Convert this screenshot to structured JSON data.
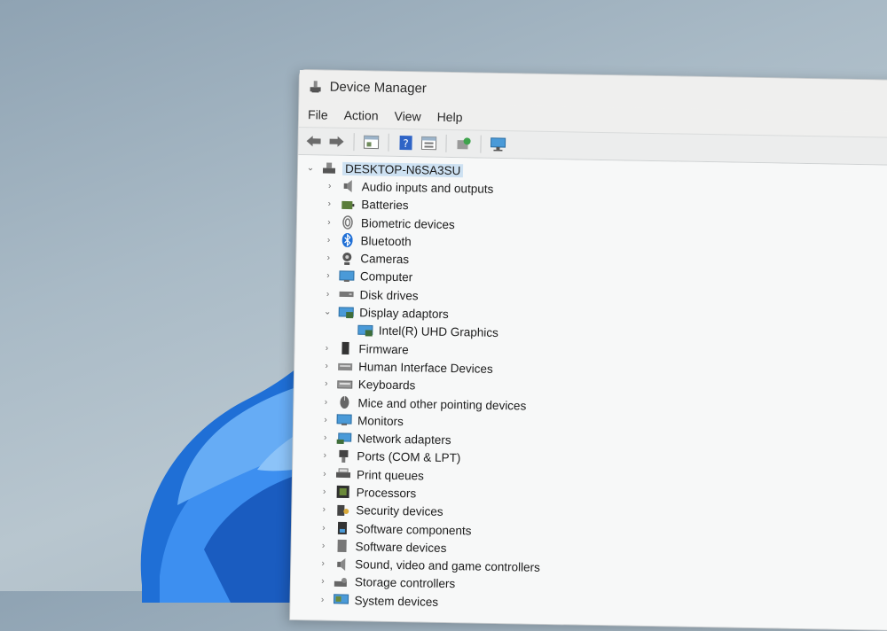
{
  "window": {
    "title": "Device Manager"
  },
  "menu": [
    "File",
    "Action",
    "View",
    "Help"
  ],
  "toolbar": [
    "back-icon",
    "forward-icon",
    "properties-icon",
    "help-icon",
    "view-icon",
    "update-driver-icon",
    "scan-hardware-icon"
  ],
  "tree": {
    "root": {
      "label": "DESKTOP-N6SA3SU",
      "expanded": true,
      "icon": "computer-icon"
    },
    "items": [
      {
        "label": "Audio inputs and outputs",
        "icon": "speaker-icon",
        "expanded": false
      },
      {
        "label": "Batteries",
        "icon": "battery-icon",
        "expanded": false
      },
      {
        "label": "Biometric devices",
        "icon": "fingerprint-icon",
        "expanded": false
      },
      {
        "label": "Bluetooth",
        "icon": "bluetooth-icon",
        "expanded": false
      },
      {
        "label": "Cameras",
        "icon": "camera-icon",
        "expanded": false
      },
      {
        "label": "Computer",
        "icon": "monitor-icon",
        "expanded": false
      },
      {
        "label": "Disk drives",
        "icon": "disk-icon",
        "expanded": false
      },
      {
        "label": "Display adaptors",
        "icon": "display-adapter-icon",
        "expanded": true,
        "children": [
          {
            "label": "Intel(R) UHD Graphics",
            "icon": "display-adapter-icon"
          }
        ]
      },
      {
        "label": "Firmware",
        "icon": "chip-icon",
        "expanded": false
      },
      {
        "label": "Human Interface Devices",
        "icon": "hid-icon",
        "expanded": false
      },
      {
        "label": "Keyboards",
        "icon": "keyboard-icon",
        "expanded": false
      },
      {
        "label": "Mice and other pointing devices",
        "icon": "mouse-icon",
        "expanded": false
      },
      {
        "label": "Monitors",
        "icon": "monitor-icon",
        "expanded": false
      },
      {
        "label": "Network adapters",
        "icon": "network-icon",
        "expanded": false
      },
      {
        "label": "Ports (COM & LPT)",
        "icon": "port-icon",
        "expanded": false
      },
      {
        "label": "Print queues",
        "icon": "printer-icon",
        "expanded": false
      },
      {
        "label": "Processors",
        "icon": "processor-icon",
        "expanded": false
      },
      {
        "label": "Security devices",
        "icon": "security-key-icon",
        "expanded": false
      },
      {
        "label": "Software components",
        "icon": "software-component-icon",
        "expanded": false
      },
      {
        "label": "Software devices",
        "icon": "software-device-icon",
        "expanded": false
      },
      {
        "label": "Sound, video and game controllers",
        "icon": "sound-icon",
        "expanded": false
      },
      {
        "label": "Storage controllers",
        "icon": "storage-icon",
        "expanded": false
      },
      {
        "label": "System devices",
        "icon": "system-icon",
        "expanded": false
      }
    ]
  },
  "colors": {
    "selection": "#cde1f2",
    "window_bg": "#f1f2f2",
    "desktop_bg": "#a9bac6",
    "bloom_blue": "#2f7fe0"
  }
}
